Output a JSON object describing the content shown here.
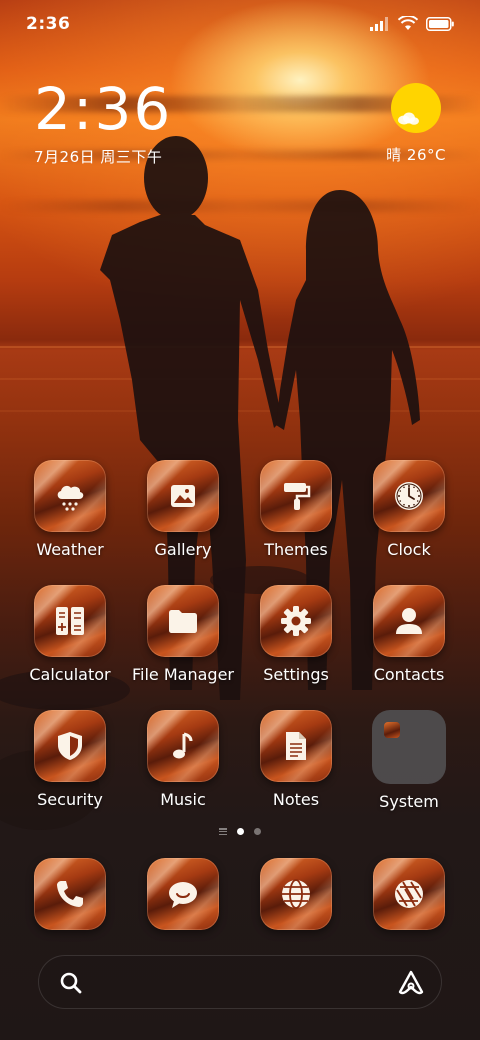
{
  "status_bar": {
    "time": "2:36",
    "icons": [
      "signal-icon",
      "wifi-icon",
      "battery-icon"
    ]
  },
  "clock_widget": {
    "time": "2:36",
    "date": "7月26日 周三下午"
  },
  "weather_widget": {
    "text": "晴 26°C",
    "icon": "sunny-partly-cloudy-icon"
  },
  "apps": [
    {
      "label": "Weather",
      "icon": "snow-cloud-icon"
    },
    {
      "label": "Gallery",
      "icon": "image-icon"
    },
    {
      "label": "Themes",
      "icon": "paint-roller-icon"
    },
    {
      "label": "Clock",
      "icon": "clock-icon"
    },
    {
      "label": "Calculator",
      "icon": "calculator-icon"
    },
    {
      "label": "File Manager",
      "icon": "folder-icon"
    },
    {
      "label": "Settings",
      "icon": "gear-icon"
    },
    {
      "label": "Contacts",
      "icon": "person-icon"
    },
    {
      "label": "Security",
      "icon": "shield-icon"
    },
    {
      "label": "Music",
      "icon": "music-note-icon"
    },
    {
      "label": "Notes",
      "icon": "document-icon"
    },
    {
      "label": "System",
      "icon": "folder-group-icon"
    }
  ],
  "page_indicator": {
    "pages": 2,
    "active": 1
  },
  "dock": [
    {
      "icon": "phone-icon"
    },
    {
      "icon": "message-icon"
    },
    {
      "icon": "globe-icon"
    },
    {
      "icon": "camera-shutter-icon"
    }
  ],
  "search_bar": {
    "left_icon": "search-icon",
    "right_icon": "assistant-icon"
  },
  "colors": {
    "icon_accent": "#e3712c",
    "glyph": "#fbf3e8",
    "sun": "#ffd400"
  }
}
